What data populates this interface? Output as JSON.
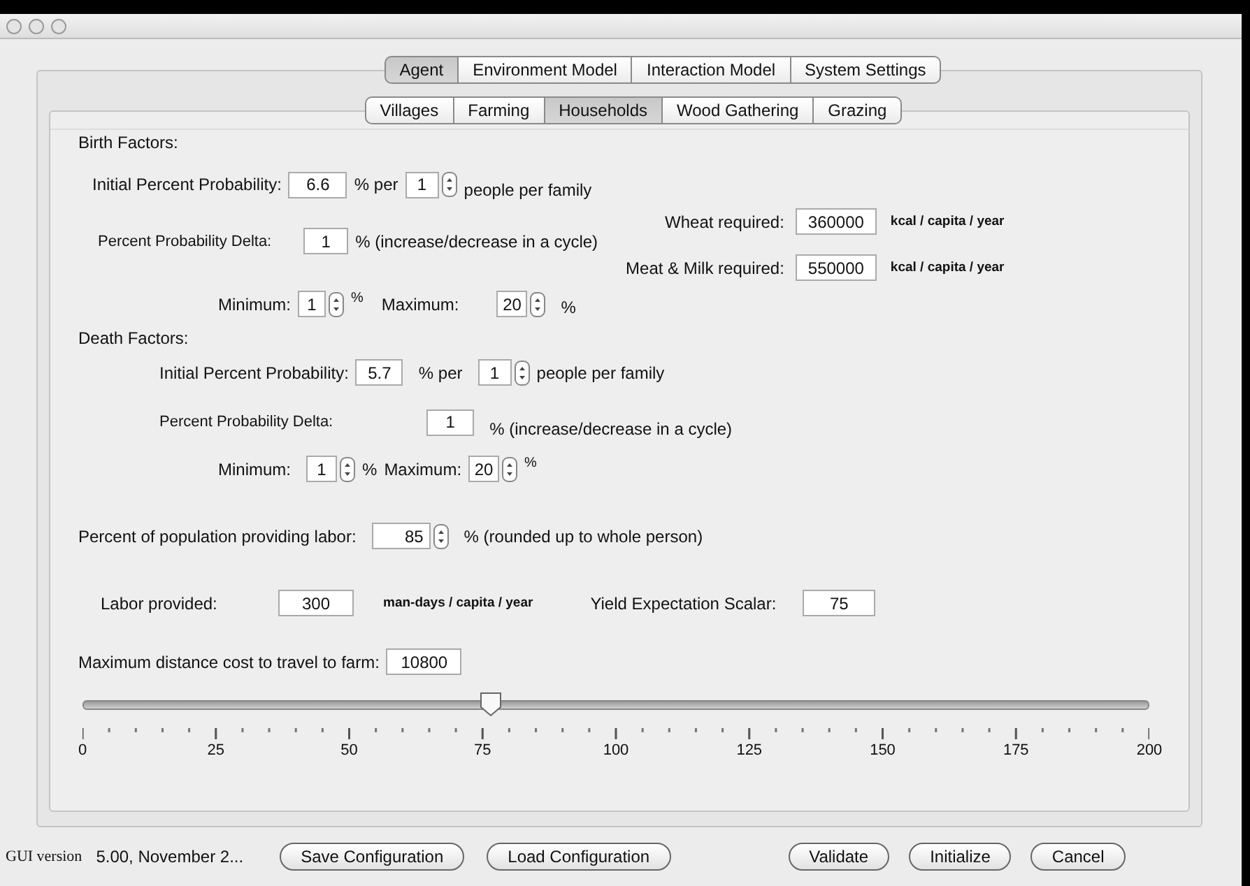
{
  "main_tabs": [
    {
      "label": "Agent",
      "selected": true
    },
    {
      "label": "Environment Model",
      "selected": false
    },
    {
      "label": "Interaction Model",
      "selected": false
    },
    {
      "label": "System Settings",
      "selected": false
    }
  ],
  "sub_tabs": [
    {
      "label": "Villages",
      "selected": false
    },
    {
      "label": "Farming",
      "selected": false
    },
    {
      "label": "Households",
      "selected": true
    },
    {
      "label": "Wood Gathering",
      "selected": false
    },
    {
      "label": "Grazing",
      "selected": false
    }
  ],
  "birth_factors": {
    "heading": "Birth Factors:",
    "initial_label": "Initial Percent Probability:",
    "initial_value": "6.6",
    "per_text": "% per",
    "people_value": "1",
    "people_text": "people per family",
    "delta_label": "Percent Probability Delta:",
    "delta_value": "1",
    "delta_text": "% (increase/decrease in a cycle)",
    "minimum_label": "Minimum:",
    "minimum_value": "1",
    "minimum_unit": "%",
    "maximum_label": "Maximum:",
    "maximum_value": "20",
    "maximum_unit": "%"
  },
  "requirements": [
    {
      "label": "Wheat required:",
      "value": "360000",
      "unit": "kcal / capita / year"
    },
    {
      "label": "Meat & Milk required:",
      "value": "550000",
      "unit": "kcal / capita / year"
    }
  ],
  "death_factors": {
    "heading": "Death Factors:",
    "initial_label": "Initial Percent Probability:",
    "initial_value": "5.7",
    "per_text": "% per",
    "people_value": "1",
    "people_text": "people per family",
    "delta_label": "Percent Probability Delta:",
    "delta_value": "1",
    "delta_text": "% (increase/decrease in a cycle)",
    "minimum_label": "Minimum:",
    "minimum_value": "1",
    "minimum_unit": "%",
    "maximum_label": "Maximum:",
    "maximum_value": "20",
    "maximum_unit": "%"
  },
  "labor": {
    "percent_label": "Percent of population providing labor:",
    "percent_value": "85",
    "percent_text": "% (rounded up to whole person)",
    "provided_label": "Labor provided:",
    "provided_value": "300",
    "provided_unit": "man-days / capita / year",
    "yield_label": "Yield Expectation Scalar:",
    "yield_value": "75",
    "distance_label": "Maximum distance cost to travel to farm:",
    "distance_value": "10800"
  },
  "slider": {
    "level": 0.375,
    "ticks": [
      "0",
      "25",
      "50",
      "75",
      "100",
      "125",
      "150",
      "175",
      "200"
    ]
  },
  "footer": {
    "version_label": "GUI version",
    "version": "5.00, November 2...",
    "buttons": [
      {
        "label": "Save Configuration"
      },
      {
        "label": "Load Configuration"
      },
      {
        "label": "Validate"
      },
      {
        "label": "Initialize"
      },
      {
        "label": "Cancel"
      }
    ]
  }
}
